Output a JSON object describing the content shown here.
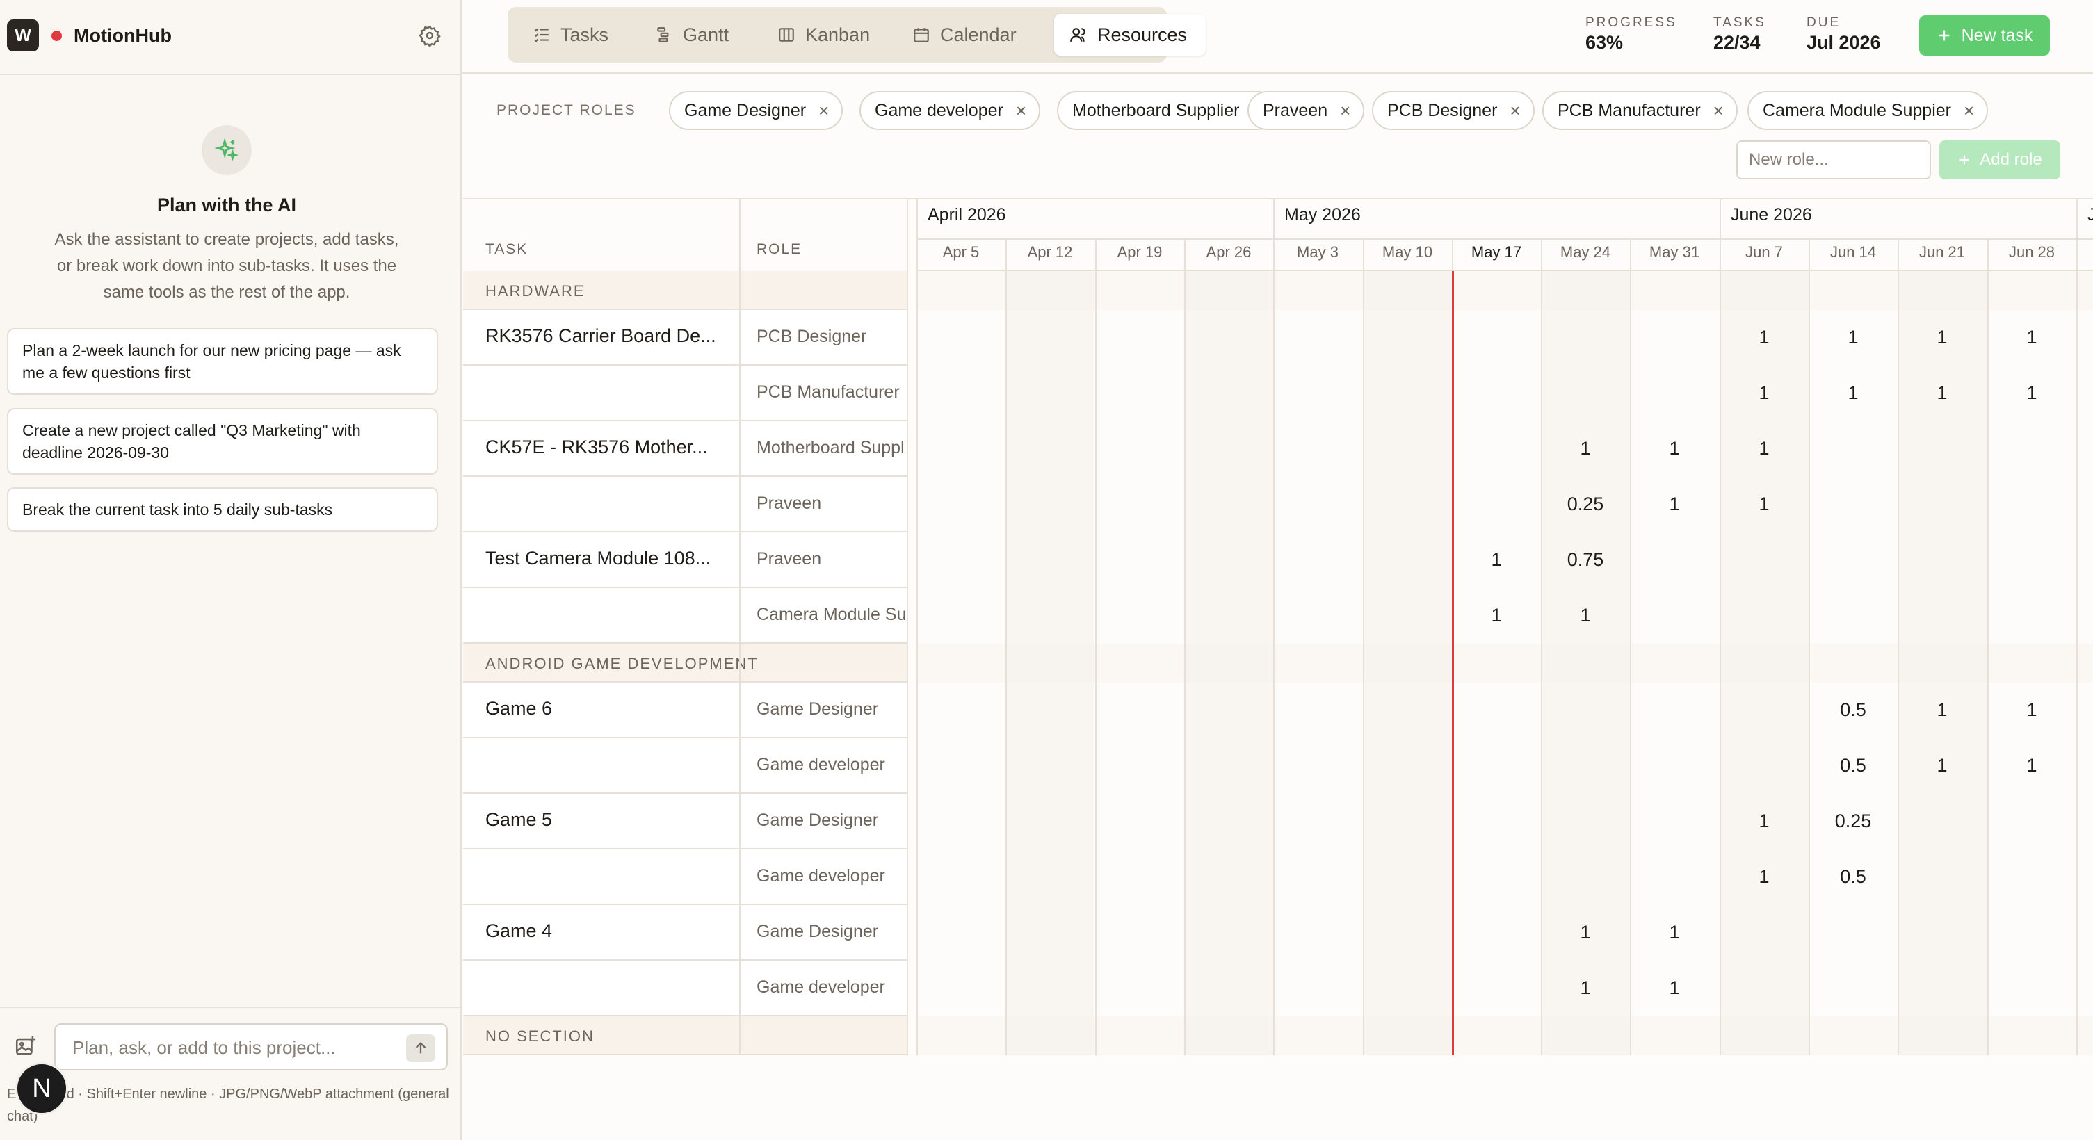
{
  "sidebar": {
    "logo_letter": "W",
    "app_name": "MotionHub",
    "ai_title": "Plan with the AI",
    "ai_description": "Ask the assistant to create projects, add tasks, or break work down into sub-tasks. It uses the same tools as the rest of the app.",
    "suggestions": [
      "Plan a 2-week launch for our new pricing page — ask me a few questions first",
      "Create a new project called \"Q3 Marketing\" with deadline 2026-09-30",
      "Break the current task into 5 daily sub-tasks"
    ],
    "chat_placeholder": "Plan, ask, or add to this project...",
    "chat_hint": "Enter send · Shift+Enter newline · JPG/PNG/WebP attachment (general chat)",
    "avatar_letter": "N"
  },
  "header": {
    "views": [
      "Tasks",
      "Gantt",
      "Kanban",
      "Calendar",
      "Resources"
    ],
    "active_view": "Resources",
    "stats": [
      {
        "label": "PROGRESS",
        "value": "63%"
      },
      {
        "label": "TASKS",
        "value": "22/34"
      },
      {
        "label": "DUE",
        "value": "Jul 2026"
      }
    ],
    "new_task_label": "New task"
  },
  "roles": {
    "label": "PROJECT ROLES",
    "chips": [
      "Game Designer",
      "Game developer",
      "Motherboard Supplier",
      "Praveen",
      "PCB Designer",
      "PCB Manufacturer",
      "Camera Module Suppier"
    ],
    "remove_glyph": "×",
    "new_role_placeholder": "New role...",
    "add_role_label": "Add role"
  },
  "table": {
    "task_header": "TASK",
    "role_header": "ROLE",
    "months": [
      "April 2026",
      "May 2026",
      "June 2026",
      "J"
    ],
    "weeks": [
      "Apr 5",
      "Apr 12",
      "Apr 19",
      "Apr 26",
      "May 3",
      "May 10",
      "May 17",
      "May 24",
      "May 31",
      "Jun 7",
      "Jun 14",
      "Jun 21",
      "Jun 28"
    ],
    "current_week": "May 17",
    "rows": [
      {
        "type": "section",
        "label": "HARDWARE"
      },
      {
        "type": "task",
        "task": "RK3576 Carrier Board De...",
        "role": "PCB Designer",
        "alloc": {
          "Jun 7": "1",
          "Jun 14": "1",
          "Jun 21": "1",
          "Jun 28": "1"
        }
      },
      {
        "type": "task",
        "task": "",
        "role": "PCB Manufacturer",
        "alloc": {
          "Jun 7": "1",
          "Jun 14": "1",
          "Jun 21": "1",
          "Jun 28": "1"
        }
      },
      {
        "type": "task",
        "task": "CK57E - RK3576 Mother...",
        "role": "Motherboard Suppl",
        "alloc": {
          "May 24": "1",
          "May 31": "1",
          "Jun 7": "1"
        }
      },
      {
        "type": "task",
        "task": "",
        "role": "Praveen",
        "alloc": {
          "May 24": "0.25",
          "May 31": "1",
          "Jun 7": "1"
        }
      },
      {
        "type": "task",
        "task": "Test Camera Module 108...",
        "role": "Praveen",
        "alloc": {
          "May 17": "1",
          "May 24": "0.75"
        }
      },
      {
        "type": "task",
        "task": "",
        "role": "Camera Module Su",
        "alloc": {
          "May 17": "1",
          "May 24": "1"
        }
      },
      {
        "type": "section",
        "label": "ANDROID GAME DEVELOPMENT"
      },
      {
        "type": "task",
        "task": "Game 6",
        "role": "Game Designer",
        "alloc": {
          "Jun 14": "0.5",
          "Jun 21": "1",
          "Jun 28": "1"
        }
      },
      {
        "type": "task",
        "task": "",
        "role": "Game developer",
        "alloc": {
          "Jun 14": "0.5",
          "Jun 21": "1",
          "Jun 28": "1"
        }
      },
      {
        "type": "task",
        "task": "Game 5",
        "role": "Game Designer",
        "alloc": {
          "Jun 7": "1",
          "Jun 14": "0.25"
        }
      },
      {
        "type": "task",
        "task": "",
        "role": "Game developer",
        "alloc": {
          "Jun 7": "1",
          "Jun 14": "0.5"
        }
      },
      {
        "type": "task",
        "task": "Game 4",
        "role": "Game Designer",
        "alloc": {
          "May 24": "1",
          "May 31": "1"
        }
      },
      {
        "type": "task",
        "task": "",
        "role": "Game developer",
        "alloc": {
          "May 24": "1",
          "May 31": "1"
        }
      },
      {
        "type": "section",
        "label": "NO SECTION"
      }
    ]
  },
  "colors": {
    "accent_green": "#5fcd6f",
    "today_line": "#e0393e",
    "status_dot": "#e0393e"
  }
}
